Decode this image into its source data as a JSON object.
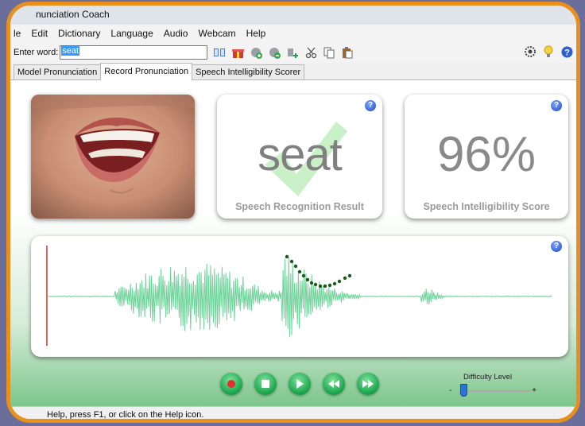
{
  "window": {
    "title": "nunciation Coach"
  },
  "menu": [
    "le",
    "Edit",
    "Dictionary",
    "Language",
    "Audio",
    "Webcam",
    "Help"
  ],
  "toolbar": {
    "enter_word_label": "Enter word:",
    "word_value": "seat"
  },
  "tabs": [
    "Model Pronunciation",
    "Record Pronunciation",
    "Speech Intelligibility Scorer"
  ],
  "active_tab": "Record Pronunciation",
  "recognition": {
    "word": "seat",
    "caption": "Speech Recognition Result"
  },
  "score": {
    "value": "96%",
    "caption": "Speech Intelligibility Score"
  },
  "difficulty": {
    "title": "Difficulty Level",
    "minus": "-",
    "plus": "+",
    "level_fraction": 0.0
  },
  "status": {
    "text": "Help, press F1, or click on the Help icon."
  },
  "colors": {
    "frame": "#e8901e",
    "waveform": "#6fd39a",
    "pitch_dots": "#1c5a1c",
    "cursor": "#c00000",
    "accent_green": "#17a34a"
  },
  "icons": {
    "toolbar": [
      "book-icon",
      "gift-icon",
      "add-audio-icon",
      "remove-audio-icon",
      "add-icon",
      "cut-icon",
      "copy-icon",
      "paste-icon"
    ],
    "toolbar_right": [
      "settings-icon",
      "lightbulb-icon",
      "help-icon"
    ],
    "controls": [
      "record-icon",
      "stop-icon",
      "play-icon",
      "rewind-icon",
      "fast-forward-icon"
    ]
  }
}
